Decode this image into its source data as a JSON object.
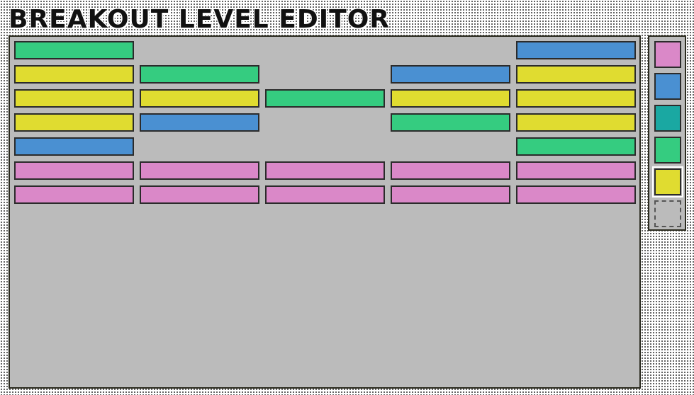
{
  "app": {
    "title": "BREAKOUT LEVEL EDITOR"
  },
  "colors": {
    "pink": "#da88c8",
    "blue": "#4a90d2",
    "teal": "#1aa8a2",
    "green": "#35cc80",
    "yellow": "#e0dc30",
    "board_bg": "#bbbbbb"
  },
  "grid": {
    "columns": 5,
    "rows": [
      [
        "green",
        null,
        null,
        null,
        "blue"
      ],
      [
        "yellow",
        "green",
        null,
        "blue",
        "yellow"
      ],
      [
        "yellow",
        "yellow",
        "green",
        "yellow",
        "yellow"
      ],
      [
        "yellow",
        "blue",
        null,
        "green",
        "yellow"
      ],
      [
        "blue",
        null,
        null,
        null,
        "green"
      ],
      [
        "pink",
        "pink",
        "pink",
        "pink",
        "pink"
      ],
      [
        "pink",
        "pink",
        "pink",
        "pink",
        "pink"
      ]
    ]
  },
  "palette": {
    "swatches": [
      "pink",
      "blue",
      "teal",
      "green",
      "yellow",
      "eraser"
    ],
    "selected": "yellow"
  }
}
